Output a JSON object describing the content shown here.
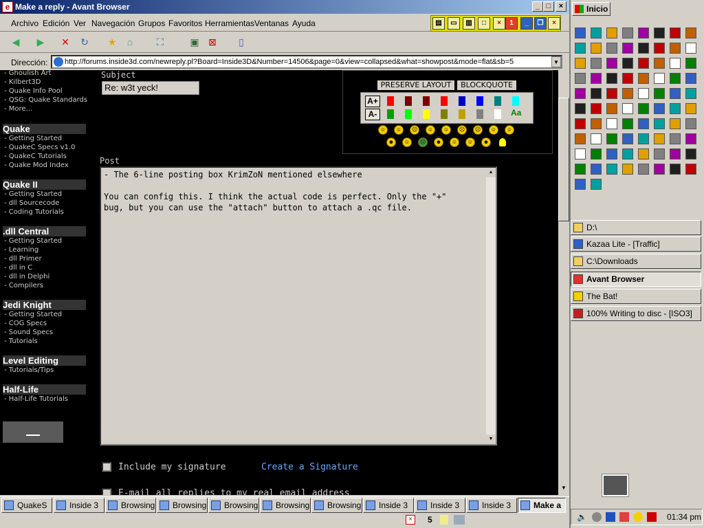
{
  "window": {
    "title": "Make a reply - Avant Browser"
  },
  "menu": [
    "Archivo",
    "Edición",
    "Ver",
    "Navegación",
    "Grupos",
    "Favoritos",
    "Herramientas",
    "Ventanas",
    "Ayuda"
  ],
  "address": {
    "label": "Dirección:",
    "url": "http://forums.inside3d.com/newreply.pl?Board=Inside3D&Number=14506&page=0&view=collapsed&what=showpost&mode=flat&sb=5"
  },
  "sidebar": {
    "top_links": [
      "- Ghoulish Art",
      "- Kilbert3D",
      "- Quake Info Pool",
      "- QSG: Quake Standards",
      "- More..."
    ],
    "sections": [
      {
        "title": "Quake",
        "links": [
          "- Getting Started",
          "- QuakeC Specs v1.0",
          "- QuakeC Tutorials",
          "- Quake Mod Index"
        ]
      },
      {
        "title": "Quake II",
        "links": [
          "- Getting Started",
          "- dll Sourcecode",
          "- Coding Tutorials"
        ]
      },
      {
        "title": ".dll Central",
        "links": [
          "- Getting Started",
          "- Learning",
          "- dll Primer",
          "- dll in C",
          "- dll in Delphi",
          "- Compilers"
        ]
      },
      {
        "title": "Jedi Knight",
        "links": [
          "- Getting Started",
          "- COG Specs",
          "- Sound Specs",
          "- Tutorials"
        ]
      },
      {
        "title": "Level Editing",
        "links": [
          "- Tutorials/Tips"
        ]
      },
      {
        "title": "Half-Life",
        "links": [
          "- Half-Life Tutorials"
        ]
      }
    ]
  },
  "form": {
    "subject_label": "Subject",
    "subject_value": "Re: w3t yeck!",
    "preserve_layout": "PRESERVE LAYOUT",
    "blockquote": "BLOCKQUOTE",
    "font_up": "A+",
    "font_down": "A-",
    "post_label": "Post",
    "post_text": "- The 6-line posting box KrimZoN mentioned elsewhere\n\nYou can config this. I think the actual code is perfect. Only the \"+\"\nbug, but you can use the \"attach\" button to attach a .qc file.",
    "signature_label": "Include my signature",
    "create_signature": "Create a Signature",
    "email_label": "E-mail all replies to my real email address"
  },
  "palette_colors": {
    "row1": [
      "#ff0000",
      "#800000",
      "#800000",
      "#ff0000",
      "#0000c0",
      "#0000ff",
      "#008080",
      "#00ffff"
    ],
    "row2": [
      "#00a000",
      "#00ff00",
      "#ffff00",
      "#808000",
      "#c0a000",
      "#808080",
      "#ffffff"
    ]
  },
  "right_panel": {
    "start_label": "Inicio",
    "tasks": [
      {
        "label": "D:\\",
        "icon": "folder-icon",
        "active": false
      },
      {
        "label": "Kazaa Lite - [Traffic]",
        "icon": "kazaa-icon",
        "active": false
      },
      {
        "label": "C:\\Downloads",
        "icon": "folder-icon",
        "active": false
      },
      {
        "label": "Avant Browser",
        "icon": "avant-icon",
        "active": true
      },
      {
        "label": "The Bat!",
        "icon": "bat-icon",
        "active": false
      },
      {
        "label": "100% Writing to disc - [ISO3]",
        "icon": "disc-icon",
        "active": false
      }
    ],
    "clock": "01:34 pm"
  },
  "taskbar": {
    "tabs": [
      {
        "label": "QuakeS",
        "active": false
      },
      {
        "label": "Inside 3",
        "active": false
      },
      {
        "label": "Browsing",
        "active": false
      },
      {
        "label": "Browsing",
        "active": false
      },
      {
        "label": "Browsing",
        "active": false
      },
      {
        "label": "Browsing",
        "active": false
      },
      {
        "label": "Browsing",
        "active": false
      },
      {
        "label": "Inside 3",
        "active": false
      },
      {
        "label": "Inside 3",
        "active": false
      },
      {
        "label": "Inside 3",
        "active": false
      },
      {
        "label": "Make a",
        "active": true
      }
    ],
    "status_count": "5"
  }
}
